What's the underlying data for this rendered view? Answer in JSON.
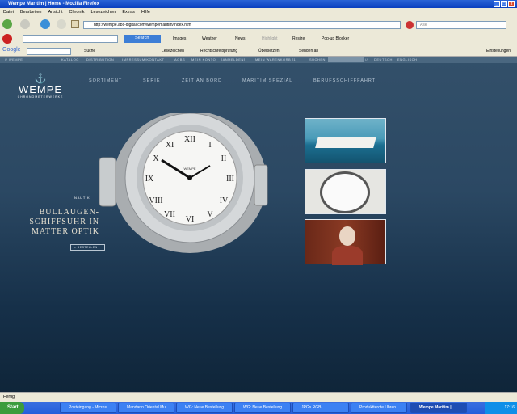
{
  "window": {
    "title": "Wempe Maritim | Home - Mozilla Firefox"
  },
  "menu": [
    "Datei",
    "Bearbeiten",
    "Ansicht",
    "Chronik",
    "Lesezeichen",
    "Extras",
    "Hilfe"
  ],
  "address": {
    "url": "http://wempe.abc-digital.com/wempemaritim/index.htm",
    "ask_placeholder": "Ask"
  },
  "toolbar2": {
    "search": "Search",
    "images": "Images",
    "weather": "Weather",
    "news": "News",
    "highlight": "Highlight",
    "resize": "Resize",
    "popup": "Pop-up Blocker"
  },
  "google": {
    "logo": "Google",
    "suche": "Suche",
    "lesezeichen": "Lesezeichen",
    "recht": "Rechtschreibprüfung",
    "uebersetzen": "Übersetzen",
    "senden": "Senden an",
    "einstellungen": "Einstellungen"
  },
  "site": {
    "topnav": [
      "// WEMPE",
      "KATALOG",
      "DISTRIBUTION",
      "IMPRESSUM/KONTAKT",
      "AGBS",
      "MEIN KONTO",
      "[ANMELDEN]",
      "MEIN WARENKORB [1]",
      "SUCHEN",
      "//",
      "DEUTSCH",
      "ENGLISCH"
    ],
    "logo": "WEMPE",
    "logo_sub": "CHRONOMETERWERKE",
    "nav": [
      "SORTIMENT",
      "SERIE",
      "ZEIT AN BORD",
      "MARITIM SPEZIAL",
      "BERUFSSCHIFFFAHRT"
    ],
    "category": "NAUTIK",
    "headline": [
      "BULLAUGEN-",
      "SCHIFFSUHR IN",
      "MATTER OPTIK"
    ],
    "order_button": "BESTELLEN",
    "clock_brand": "WEMPE"
  },
  "status": "Fertig",
  "taskbar": {
    "start": "Start",
    "tasks": [
      "Posteingang - Micros...",
      "Mandarin Oriental Mu...",
      "WG: Neue Bestellung...",
      "WG: Neue Bestellung...",
      "JPGs RGB",
      "Produktterote Uhren",
      "Wempe Maritim | ..."
    ],
    "time": "17:16"
  }
}
